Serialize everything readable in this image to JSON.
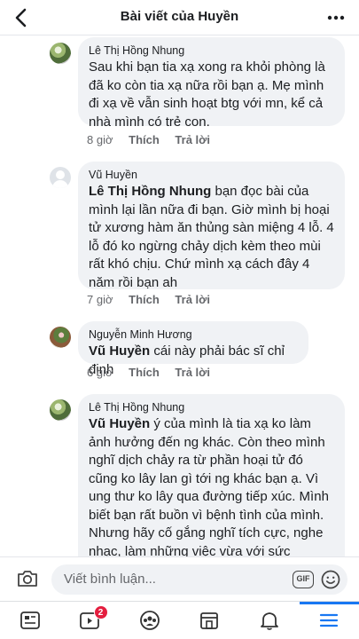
{
  "header": {
    "title": "Bài viết của Huyền",
    "back_icon": "chevron-left-icon",
    "more_icon": "more-horizontal-icon"
  },
  "comments": [
    {
      "author": "Lê Thị Hồng Nhung",
      "mention": "",
      "text": "Sau khi bạn tia xạ xong ra khỏi phòng là đã ko còn tia xạ nữa rồi bạn ạ. Mẹ mình đi xạ về vẫn sinh hoạt btg với mn, kể cả nhà mình có trẻ con.",
      "time": "8 giờ",
      "like": "Thích",
      "reply": "Trả lời",
      "avatar": "photo"
    },
    {
      "author": "Vũ Huyền",
      "mention": "Lê Thị Hồng Nhung",
      "text": " bạn đọc bài của mình lại lần nữa đi bạn. Giờ mình bị hoại tử xương hàm ăn thủng sàn miệng 4 lỗ. 4 lỗ đó ko ngừng chảy dịch kèm theo mùi rất khó chịu. Chứ mình xạ cách đây 4 năm rồi bạn ah",
      "time": "7 giờ",
      "like": "Thích",
      "reply": "Trả lời",
      "avatar": "default"
    },
    {
      "author": "Nguyễn Minh Hương",
      "mention": "Vũ Huyền",
      "text": " cái này phải bác sĩ chỉ định",
      "time": "6 giờ",
      "like": "Thích",
      "reply": "Trả lời",
      "avatar": "photo2"
    },
    {
      "author": "Lê Thị Hồng Nhung",
      "mention": "Vũ Huyền",
      "text": " ý của mình là tia xạ ko làm ảnh hưởng đến ng khác. Còn theo mình nghĩ dịch chảy ra từ phần hoại tử đó cũng ko lây lan gì tới ng khác bạn ạ. Vì ung thư ko lây qua đường tiếp xúc. Mình biết bạn rất buồn vì bệnh tình của mình. Nhưng hãy cố gắng nghĩ tích cực, nghe nhạc, làm những việc vừa với sức",
      "time": "",
      "like": "",
      "reply": "",
      "avatar": "photo"
    }
  ],
  "composer": {
    "placeholder": "Viết bình luận...",
    "gif_label": "GIF"
  },
  "tabbar": {
    "tabs": [
      {
        "icon": "news-feed-icon",
        "badge": ""
      },
      {
        "icon": "watch-icon",
        "badge": "2"
      },
      {
        "icon": "groups-icon",
        "badge": ""
      },
      {
        "icon": "marketplace-icon",
        "badge": ""
      },
      {
        "icon": "bell-icon",
        "badge": ""
      },
      {
        "icon": "menu-icon",
        "badge": ""
      }
    ],
    "active_index": 5
  },
  "colors": {
    "accent": "#1877f2",
    "bubble": "#f0f2f5",
    "secondary_text": "#65676b",
    "badge": "#e41e3f"
  }
}
